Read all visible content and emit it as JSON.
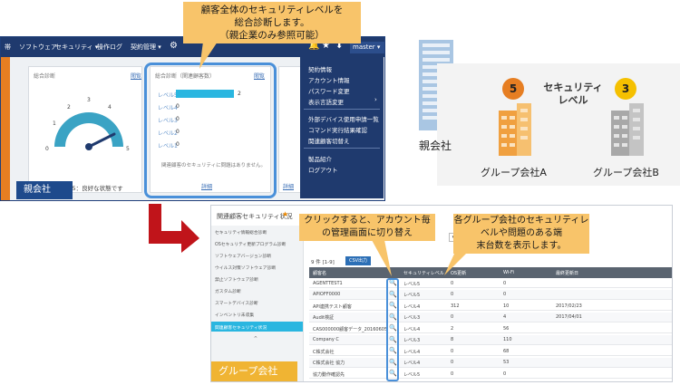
{
  "callouts": {
    "top": "顧客全体のセキュリティレベルを\n総合診断します。\n（親企業のみ参照可能）",
    "click": "クリックすると、アカウント毎\nの管理画面に切り替え",
    "right": "各グループ会社のセキュリティレベルや問題のある端\n末台数を表示します。"
  },
  "parent": {
    "nav": [
      "ソフトウェア",
      "セキュリティ ▾",
      "操作ログ",
      "契約管理 ▾"
    ],
    "master_label": "master ▾",
    "card1": {
      "title": "総合診断",
      "link": "閲覧",
      "gauge_ticks": [
        "0",
        "1",
        "2",
        "3",
        "4",
        "5"
      ],
      "status": "レベル5：良好な状態です"
    },
    "card2": {
      "title": "総合診断（関連顧客数）",
      "link": "閲覧",
      "levels": [
        {
          "label": "レベル5",
          "value": "2"
        },
        {
          "label": "レベル4",
          "value": "0"
        },
        {
          "label": "レベル3",
          "value": "0"
        },
        {
          "label": "レベル2",
          "value": "0"
        },
        {
          "label": "レベル1",
          "value": "0"
        }
      ],
      "level5_fill": 1.0,
      "message": "関連顧客のセキュリティに問題はありません。",
      "detail": "詳細"
    },
    "card3_detail": "詳細",
    "dropdown": {
      "group1": [
        "契約情報",
        "アカウント情報",
        "パスワード変更",
        "表示言語変更"
      ],
      "group2": [
        "外部デバイス使用申請一覧",
        "コマンド実行結果確認",
        "関連顧客切替え"
      ],
      "group3": [
        "製品紹介",
        "ログアウト"
      ]
    },
    "label": "親会社"
  },
  "org": {
    "parent_label": "親会社",
    "security_title": "セキュリティ\nレベル",
    "company_a": {
      "name": "グループ会社A",
      "level": "5",
      "color": "#e67e22"
    },
    "company_b": {
      "name": "グループ会社B",
      "level": "3",
      "color": "#f5c000"
    }
  },
  "group": {
    "title": "関連顧客セキュリティ状況",
    "side_items": [
      "セキュリティ情報総合診断",
      "OSセキュリティ更新プログラム診断",
      "ソフトウェアバージョン診断",
      "ウイルス対策ソフトウェア診断",
      "禁止ソフトウェア診断",
      "ガスタム診断",
      "スマートデバイス診断",
      "インベントリ未収集",
      "関連顧客セキュリティ状況"
    ],
    "result_count": "9 件 [1-9]",
    "csv_button": "CSV出力",
    "headers": [
      "顧客名",
      "セキュリティレベル",
      "OS更新",
      "Wi-Fi",
      "最終更新日"
    ],
    "rows": [
      [
        "AGENTTEST1",
        "レベル5",
        "0",
        "0",
        ""
      ],
      [
        "APIOFF0000",
        "レベル5",
        "0",
        "0",
        ""
      ],
      [
        "API連携テスト顧客",
        "レベル4",
        "312",
        "10",
        "2017/02/23"
      ],
      [
        "Audit検証",
        "レベル3",
        "0",
        "4",
        "2017/04/01"
      ],
      [
        "CAS000000顧客データ_20160605",
        "レベル4",
        "2",
        "56",
        ""
      ],
      [
        "Company C",
        "レベル3",
        "8",
        "110",
        ""
      ],
      [
        "C株式会社",
        "レベル4",
        "0",
        "68",
        ""
      ],
      [
        "C株式会社 協力",
        "レベル4",
        "0",
        "53",
        ""
      ],
      [
        "協力動作確認先",
        "レベル5",
        "0",
        "0",
        ""
      ]
    ],
    "label": "グループ会社"
  },
  "colors": {
    "nav": "#1f3a6e",
    "orange": "#f8c46a",
    "level_bar": "#2ab6e0",
    "highlight": "#4a90d9"
  }
}
